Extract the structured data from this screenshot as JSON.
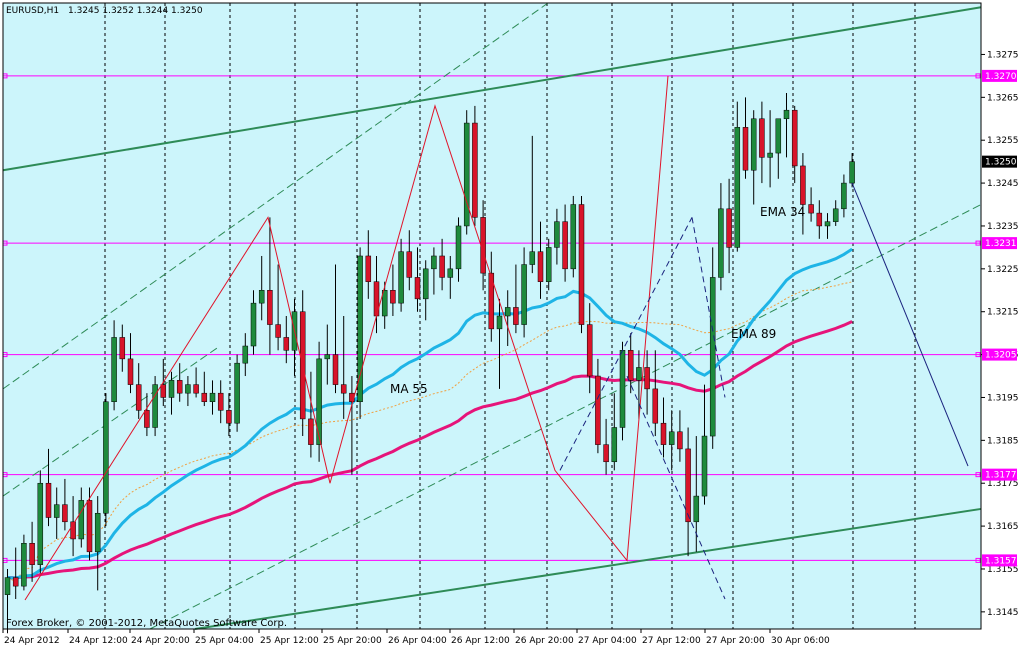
{
  "header": {
    "symbol": "EURUSD,H1",
    "ohlc": "1.3245 1.3252 1.3244 1.3250"
  },
  "footer": {
    "copyright": "Forex Broker, © 2001-2012, MetaQuotes Software Corp."
  },
  "colors": {
    "background": "#ffffff",
    "chart_area": "#ccf5fb",
    "bull_candle": "#1e8a3c",
    "bear_candle": "#d8142a",
    "wick": "#000000",
    "horizontal_levels": "#ff00ff",
    "channel": "#2e8b57",
    "ema34": "#1eb4e6",
    "ema89": "#e6147a",
    "ma55": "#f0a040",
    "zigzag": "#e0142a",
    "projection": "#1a237e"
  },
  "chart_data": {
    "type": "candlestick",
    "symbol": "EURUSD",
    "timeframe": "H1",
    "title": "EURUSD,H1",
    "ylim": [
      1.3141,
      1.3287
    ],
    "grid": true,
    "y_ticks": [
      "1.3275",
      "1.3265",
      "1.3255",
      "1.3245",
      "1.3235",
      "1.3225",
      "1.3215",
      "1.3205",
      "1.3195",
      "1.3185",
      "1.3175",
      "1.3165",
      "1.3155",
      "1.3145"
    ],
    "x_ticks": [
      "24 Apr 2012",
      "24 Apr 12:00",
      "24 Apr 20:00",
      "25 Apr 04:00",
      "25 Apr 12:00",
      "25 Apr 20:00",
      "26 Apr 04:00",
      "26 Apr 12:00",
      "26 Apr 20:00",
      "27 Apr 04:00",
      "27 Apr 12:00",
      "27 Apr 20:00",
      "30 Apr 06:00"
    ],
    "current_price": "1.3250",
    "levels": [
      {
        "price": 1.327,
        "label": "1.3270"
      },
      {
        "price": 1.3231,
        "label": "1.3231"
      },
      {
        "price": 1.3205,
        "label": "1.3205"
      },
      {
        "price": 1.3177,
        "label": "1.3177"
      },
      {
        "price": 1.3157,
        "label": "1.3157"
      }
    ],
    "annotations": [
      "EMA 34",
      "EMA 89",
      "MA 55"
    ],
    "candles": [
      [
        1.3149,
        1.3155,
        1.314,
        1.3153
      ],
      [
        1.3153,
        1.316,
        1.3148,
        1.3151
      ],
      [
        1.3151,
        1.3163,
        1.315,
        1.3161
      ],
      [
        1.3161,
        1.3166,
        1.3152,
        1.3156
      ],
      [
        1.3156,
        1.3178,
        1.3154,
        1.3175
      ],
      [
        1.3175,
        1.3183,
        1.3165,
        1.3167
      ],
      [
        1.3167,
        1.3174,
        1.3162,
        1.317
      ],
      [
        1.317,
        1.3176,
        1.3164,
        1.3166
      ],
      [
        1.3166,
        1.3172,
        1.3158,
        1.3162
      ],
      [
        1.3162,
        1.3174,
        1.316,
        1.3171
      ],
      [
        1.3171,
        1.3174,
        1.3157,
        1.3159
      ],
      [
        1.3159,
        1.3172,
        1.315,
        1.3168
      ],
      [
        1.3168,
        1.3196,
        1.3165,
        1.3194
      ],
      [
        1.3194,
        1.3213,
        1.3192,
        1.3209
      ],
      [
        1.3209,
        1.3212,
        1.3201,
        1.3204
      ],
      [
        1.3204,
        1.321,
        1.3196,
        1.3198
      ],
      [
        1.3198,
        1.3203,
        1.319,
        1.3192
      ],
      [
        1.3192,
        1.3196,
        1.3186,
        1.3188
      ],
      [
        1.3188,
        1.32,
        1.3186,
        1.3198
      ],
      [
        1.3198,
        1.3204,
        1.3193,
        1.3195
      ],
      [
        1.3195,
        1.3201,
        1.3191,
        1.3199
      ],
      [
        1.3199,
        1.3203,
        1.3194,
        1.3196
      ],
      [
        1.3196,
        1.32,
        1.3193,
        1.3198
      ],
      [
        1.3198,
        1.3202,
        1.3195,
        1.3196
      ],
      [
        1.3196,
        1.3201,
        1.3193,
        1.3194
      ],
      [
        1.3194,
        1.3199,
        1.3191,
        1.3196
      ],
      [
        1.3196,
        1.3199,
        1.3189,
        1.3192
      ],
      [
        1.3192,
        1.3196,
        1.3186,
        1.3189
      ],
      [
        1.3189,
        1.3205,
        1.3187,
        1.3203
      ],
      [
        1.3203,
        1.321,
        1.32,
        1.3207
      ],
      [
        1.3207,
        1.322,
        1.3205,
        1.3217
      ],
      [
        1.3217,
        1.3228,
        1.3213,
        1.322
      ],
      [
        1.322,
        1.3237,
        1.3205,
        1.3212
      ],
      [
        1.3212,
        1.3226,
        1.3206,
        1.3209
      ],
      [
        1.3209,
        1.3214,
        1.3203,
        1.3206
      ],
      [
        1.3206,
        1.3218,
        1.32,
        1.3215
      ],
      [
        1.3215,
        1.322,
        1.3186,
        1.319
      ],
      [
        1.319,
        1.3201,
        1.3181,
        1.3184
      ],
      [
        1.3184,
        1.3208,
        1.318,
        1.3204
      ],
      [
        1.3204,
        1.3212,
        1.3198,
        1.3205
      ],
      [
        1.3205,
        1.3226,
        1.3196,
        1.3198
      ],
      [
        1.3198,
        1.3214,
        1.319,
        1.3196
      ],
      [
        1.3196,
        1.32,
        1.3177,
        1.3194
      ],
      [
        1.3194,
        1.323,
        1.319,
        1.3228
      ],
      [
        1.3228,
        1.3234,
        1.3218,
        1.3222
      ],
      [
        1.3222,
        1.3228,
        1.321,
        1.3214
      ],
      [
        1.3214,
        1.3222,
        1.3211,
        1.322
      ],
      [
        1.322,
        1.3226,
        1.3214,
        1.3217
      ],
      [
        1.3217,
        1.3232,
        1.3215,
        1.3229
      ],
      [
        1.3229,
        1.3234,
        1.322,
        1.3223
      ],
      [
        1.3223,
        1.323,
        1.3215,
        1.3218
      ],
      [
        1.3218,
        1.3227,
        1.3213,
        1.3225
      ],
      [
        1.3225,
        1.323,
        1.3219,
        1.3228
      ],
      [
        1.3228,
        1.3232,
        1.322,
        1.3223
      ],
      [
        1.3223,
        1.3228,
        1.3218,
        1.3225
      ],
      [
        1.3225,
        1.3237,
        1.3222,
        1.3235
      ],
      [
        1.3235,
        1.3262,
        1.3233,
        1.3259
      ],
      [
        1.3259,
        1.3263,
        1.3235,
        1.3237
      ],
      [
        1.3237,
        1.3241,
        1.322,
        1.3224
      ],
      [
        1.3224,
        1.3229,
        1.3208,
        1.3211
      ],
      [
        1.3211,
        1.3218,
        1.3197,
        1.3214
      ],
      [
        1.3214,
        1.322,
        1.3207,
        1.3216
      ],
      [
        1.3216,
        1.3226,
        1.321,
        1.3212
      ],
      [
        1.3212,
        1.323,
        1.3209,
        1.3226
      ],
      [
        1.3226,
        1.3256,
        1.3224,
        1.3229
      ],
      [
        1.3229,
        1.3236,
        1.3218,
        1.3222
      ],
      [
        1.3222,
        1.3232,
        1.322,
        1.323
      ],
      [
        1.323,
        1.3239,
        1.3226,
        1.3236
      ],
      [
        1.3236,
        1.324,
        1.3222,
        1.3225
      ],
      [
        1.3225,
        1.3242,
        1.3223,
        1.324
      ],
      [
        1.324,
        1.3242,
        1.321,
        1.3212
      ],
      [
        1.3212,
        1.3217,
        1.3196,
        1.32
      ],
      [
        1.32,
        1.3204,
        1.3182,
        1.3184
      ],
      [
        1.3184,
        1.319,
        1.3177,
        1.318
      ],
      [
        1.318,
        1.3196,
        1.3178,
        1.3188
      ],
      [
        1.3188,
        1.3208,
        1.3185,
        1.3206
      ],
      [
        1.3206,
        1.321,
        1.3196,
        1.3199
      ],
      [
        1.3199,
        1.3206,
        1.319,
        1.3202
      ],
      [
        1.3202,
        1.3206,
        1.3191,
        1.3197
      ],
      [
        1.3197,
        1.3206,
        1.3186,
        1.3189
      ],
      [
        1.3189,
        1.3195,
        1.3181,
        1.3184
      ],
      [
        1.3184,
        1.3192,
        1.3178,
        1.3187
      ],
      [
        1.3187,
        1.3192,
        1.318,
        1.3183
      ],
      [
        1.3183,
        1.3188,
        1.3158,
        1.3166
      ],
      [
        1.3166,
        1.3186,
        1.3159,
        1.3172
      ],
      [
        1.3172,
        1.3198,
        1.317,
        1.3186
      ],
      [
        1.3186,
        1.323,
        1.3183,
        1.3223
      ],
      [
        1.3223,
        1.3245,
        1.322,
        1.3239
      ],
      [
        1.3239,
        1.3246,
        1.3224,
        1.323
      ],
      [
        1.323,
        1.3264,
        1.3229,
        1.3258
      ],
      [
        1.3258,
        1.3265,
        1.3246,
        1.3248
      ],
      [
        1.3248,
        1.3262,
        1.324,
        1.326
      ],
      [
        1.326,
        1.3264,
        1.3245,
        1.3251
      ],
      [
        1.3251,
        1.3262,
        1.3244,
        1.3252
      ],
      [
        1.3252,
        1.3257,
        1.3246,
        1.326
      ],
      [
        1.326,
        1.3266,
        1.3251,
        1.3262
      ],
      [
        1.3262,
        1.3263,
        1.3245,
        1.3249
      ],
      [
        1.3249,
        1.3252,
        1.3233,
        1.324
      ],
      [
        1.324,
        1.3244,
        1.3236,
        1.3238
      ],
      [
        1.3238,
        1.3241,
        1.3232,
        1.3235
      ],
      [
        1.3235,
        1.3238,
        1.3232,
        1.3236
      ],
      [
        1.3236,
        1.3241,
        1.3235,
        1.3239
      ],
      [
        1.3239,
        1.3247,
        1.3237,
        1.3245
      ],
      [
        1.3245,
        1.3252,
        1.3244,
        1.325
      ]
    ]
  }
}
